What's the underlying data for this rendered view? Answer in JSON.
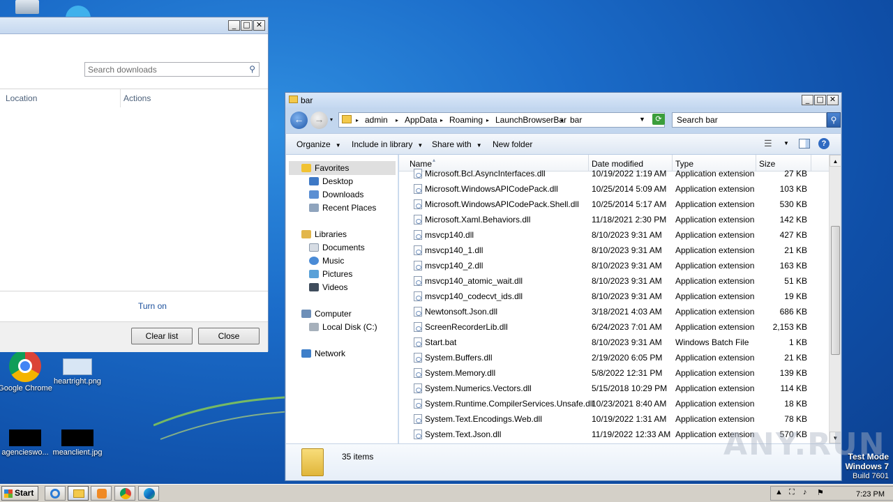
{
  "desktop": {
    "icons": [
      {
        "label": "Google Chrome"
      },
      {
        "label": "heartright.png"
      },
      {
        "label": "agencieswo..."
      },
      {
        "label": "meanclient.jpg"
      }
    ],
    "watermark": {
      "line1": "Test Mode",
      "line2": "Windows 7",
      "line3": "Build 7601"
    },
    "brand": "ANY.RUN"
  },
  "downloads_window": {
    "search_placeholder": "Search downloads",
    "col_location": "Location",
    "col_actions": "Actions",
    "turn_on": "Turn on",
    "clear_list": "Clear list",
    "close": "Close"
  },
  "explorer": {
    "title": "bar",
    "breadcrumbs": [
      "admin",
      "AppData",
      "Roaming",
      "LaunchBrowserBar",
      "bar"
    ],
    "search_placeholder": "Search bar",
    "toolbar": {
      "organize": "Organize",
      "include": "Include in library",
      "share": "Share with",
      "new_folder": "New folder"
    },
    "nav": {
      "favorites": "Favorites",
      "desktop": "Desktop",
      "downloads": "Downloads",
      "recent": "Recent Places",
      "libraries": "Libraries",
      "documents": "Documents",
      "music": "Music",
      "pictures": "Pictures",
      "videos": "Videos",
      "computer": "Computer",
      "local_disk": "Local Disk (C:)",
      "network": "Network"
    },
    "columns": {
      "name": "Name",
      "date": "Date modified",
      "type": "Type",
      "size": "Size"
    },
    "files": [
      {
        "name": "Microsoft.Bcl.AsyncInterfaces.dll",
        "date": "10/19/2022 1:19 AM",
        "type": "Application extension",
        "size": "27 KB"
      },
      {
        "name": "Microsoft.WindowsAPICodePack.dll",
        "date": "10/25/2014 5:09 AM",
        "type": "Application extension",
        "size": "103 KB"
      },
      {
        "name": "Microsoft.WindowsAPICodePack.Shell.dll",
        "date": "10/25/2014 5:17 AM",
        "type": "Application extension",
        "size": "530 KB"
      },
      {
        "name": "Microsoft.Xaml.Behaviors.dll",
        "date": "11/18/2021 2:30 PM",
        "type": "Application extension",
        "size": "142 KB"
      },
      {
        "name": "msvcp140.dll",
        "date": "8/10/2023 9:31 AM",
        "type": "Application extension",
        "size": "427 KB"
      },
      {
        "name": "msvcp140_1.dll",
        "date": "8/10/2023 9:31 AM",
        "type": "Application extension",
        "size": "21 KB"
      },
      {
        "name": "msvcp140_2.dll",
        "date": "8/10/2023 9:31 AM",
        "type": "Application extension",
        "size": "163 KB"
      },
      {
        "name": "msvcp140_atomic_wait.dll",
        "date": "8/10/2023 9:31 AM",
        "type": "Application extension",
        "size": "51 KB"
      },
      {
        "name": "msvcp140_codecvt_ids.dll",
        "date": "8/10/2023 9:31 AM",
        "type": "Application extension",
        "size": "19 KB"
      },
      {
        "name": "Newtonsoft.Json.dll",
        "date": "3/18/2021 4:03 AM",
        "type": "Application extension",
        "size": "686 KB"
      },
      {
        "name": "ScreenRecorderLib.dll",
        "date": "6/24/2023 7:01 AM",
        "type": "Application extension",
        "size": "2,153 KB"
      },
      {
        "name": "Start.bat",
        "date": "8/10/2023 9:31 AM",
        "type": "Windows Batch File",
        "size": "1 KB"
      },
      {
        "name": "System.Buffers.dll",
        "date": "2/19/2020 6:05 PM",
        "type": "Application extension",
        "size": "21 KB"
      },
      {
        "name": "System.Memory.dll",
        "date": "5/8/2022 12:31 PM",
        "type": "Application extension",
        "size": "139 KB"
      },
      {
        "name": "System.Numerics.Vectors.dll",
        "date": "5/15/2018 10:29 PM",
        "type": "Application extension",
        "size": "114 KB"
      },
      {
        "name": "System.Runtime.CompilerServices.Unsafe.dll",
        "date": "10/23/2021 8:40 AM",
        "type": "Application extension",
        "size": "18 KB"
      },
      {
        "name": "System.Text.Encodings.Web.dll",
        "date": "10/19/2022 1:31 AM",
        "type": "Application extension",
        "size": "78 KB"
      },
      {
        "name": "System.Text.Json.dll",
        "date": "11/19/2022 12:33 AM",
        "type": "Application extension",
        "size": "570 KB"
      }
    ],
    "item_count": "35 items"
  },
  "taskbar": {
    "start": "Start",
    "clock": "7:23 PM"
  }
}
